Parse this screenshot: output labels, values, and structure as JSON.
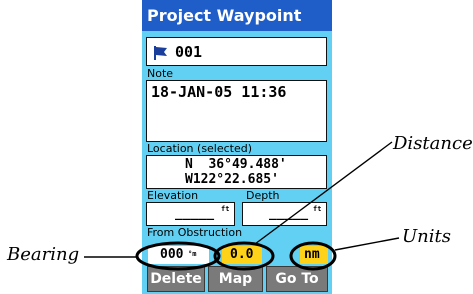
{
  "screen": {
    "title": "Project Waypoint",
    "waypoint_name": "001",
    "note_label": "Note",
    "note_value": "18-JAN-05 11:36",
    "location_label": "Location (selected)",
    "lat": "N  36°49.488'",
    "lon": "W122°22.685'",
    "elevation_label": "Elevation",
    "depth_label": "Depth",
    "elevation_value": "_____",
    "elevation_unit": "ft",
    "depth_value": "_____",
    "depth_unit": "ft",
    "obstruction_label": "From Obstruction",
    "bearing_value": "000",
    "bearing_unit": "°m",
    "distance_value": "0.0",
    "units_value": "nm"
  },
  "buttons": {
    "delete": "Delete",
    "map": "Map",
    "goto": "Go To"
  },
  "callouts": {
    "distance": "Distance",
    "units": "Units",
    "bearing": "Bearing"
  },
  "colors": {
    "title_bg": "#1f5ec8",
    "screen_bg": "#61d0f2",
    "highlight": "#ffd21a",
    "button_bg": "#7a7a7a"
  },
  "icons": {
    "waypoint_symbol": "flag-icon"
  }
}
